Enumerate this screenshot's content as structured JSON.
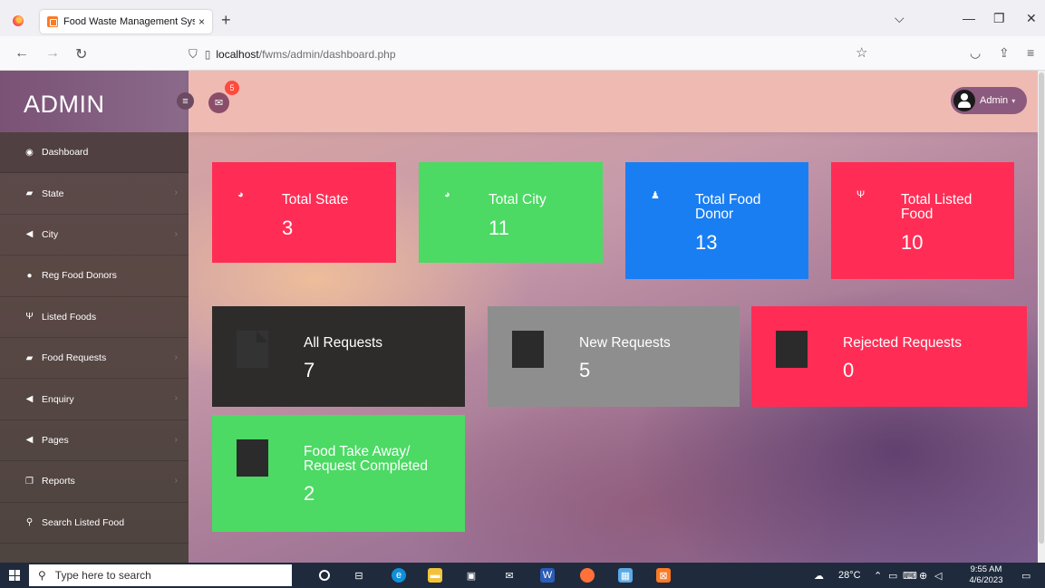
{
  "browser": {
    "tab_title": "Food Waste Management Syste",
    "tab_close": "×",
    "new_tab": "+",
    "url_host": "localhost",
    "url_path": "/fwms/admin/dashboard.php",
    "window_controls": [
      "⌵",
      "—",
      "❐",
      "✕"
    ]
  },
  "sidebar": {
    "brand": "ADMIN",
    "items": [
      {
        "label": "Dashboard",
        "icon": "dashboard-icon",
        "glyph": "◉",
        "active": true,
        "chevron": false
      },
      {
        "label": "State",
        "icon": "book-icon",
        "glyph": "▰",
        "chevron": true
      },
      {
        "label": "City",
        "icon": "bullhorn-icon",
        "glyph": "◀",
        "chevron": true
      },
      {
        "label": "Reg Food Donors",
        "icon": "users-icon",
        "glyph": "●",
        "chevron": false
      },
      {
        "label": "Listed Foods",
        "icon": "cutlery-icon",
        "glyph": "Ψ",
        "chevron": false
      },
      {
        "label": "Food Requests",
        "icon": "book-icon",
        "glyph": "▰",
        "chevron": true
      },
      {
        "label": "Enquiry",
        "icon": "bullhorn-icon",
        "glyph": "◀",
        "chevron": true
      },
      {
        "label": "Pages",
        "icon": "bullhorn-icon",
        "glyph": "◀",
        "chevron": true
      },
      {
        "label": "Reports",
        "icon": "copy-icon",
        "glyph": "❐",
        "chevron": true
      },
      {
        "label": "Search Listed Food",
        "icon": "search-icon",
        "glyph": "⚲",
        "chevron": false
      }
    ]
  },
  "topbar": {
    "toggle_glyph": "≡",
    "mail_glyph": "✉",
    "mail_badge": "5",
    "admin_label": "Admin",
    "admin_caret": "▾"
  },
  "stats": [
    {
      "title": "Total State",
      "value": "3",
      "color": "#ff2d55",
      "icon": "globe-icon"
    },
    {
      "title": "Total City",
      "value": "11",
      "color": "#4cd964",
      "icon": "globe-icon"
    },
    {
      "title": "Total Food Donor",
      "value": "13",
      "color": "#1a7ef3",
      "icon": "user-icon"
    },
    {
      "title": "Total Listed Food",
      "value": "10",
      "color": "#ff2d55",
      "icon": "cutlery-icon"
    }
  ],
  "requests": [
    {
      "title": "All Requests",
      "value": "7",
      "color": "#2e2b2b"
    },
    {
      "title": "New Requests",
      "value": "5",
      "color": "#8e8e8e"
    },
    {
      "title": "Rejected Requests",
      "value": "0",
      "color": "#ff2d55"
    },
    {
      "title": "Food Take Away/ Request Completed",
      "value": "2",
      "color": "#4cd964"
    }
  ],
  "taskbar": {
    "search_placeholder": "Type here to search",
    "weather": "28°C",
    "time": "9:55 AM",
    "date": "4/6/2023"
  }
}
